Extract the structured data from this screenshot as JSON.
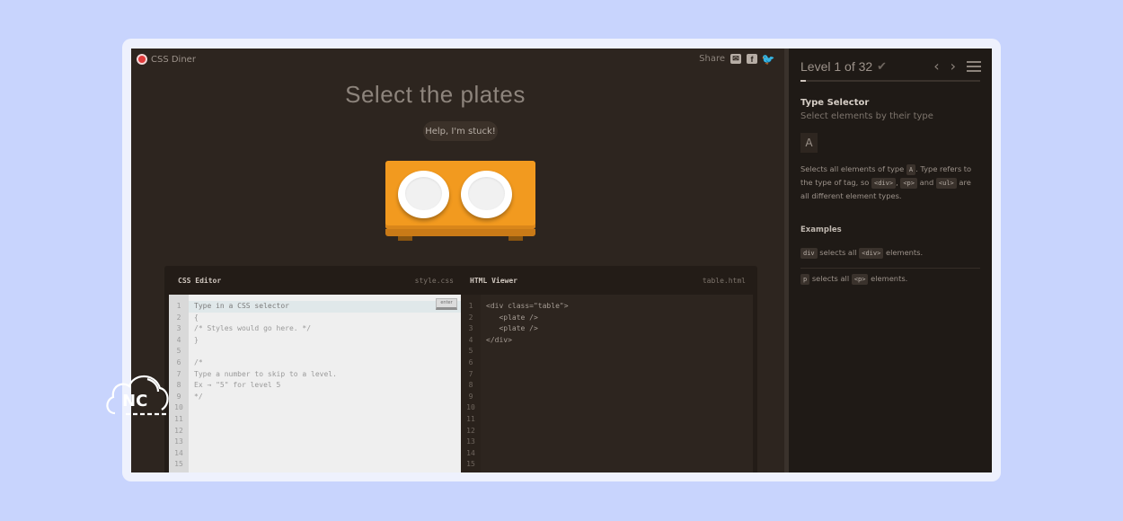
{
  "brand": {
    "name": "CSS Diner"
  },
  "share": {
    "label": "Share",
    "icons": [
      "email-icon",
      "facebook-icon",
      "twitter-icon"
    ]
  },
  "challenge": {
    "title": "Select the plates",
    "help_label": "Help, I'm stuck!"
  },
  "editor": {
    "css": {
      "title": "CSS Editor",
      "file": "style.css",
      "enter_label": "enter",
      "line_numbers": [
        "1",
        "2",
        "3",
        "4",
        "5",
        "6",
        "7",
        "8",
        "9",
        "10",
        "11",
        "12",
        "13",
        "14",
        "15"
      ],
      "lines": [
        "Type in a CSS selector",
        "{",
        "/* Styles would go here. */",
        "}",
        "",
        "/*",
        "Type a number to skip to a level.",
        "Ex → \"5\" for level 5",
        "*/"
      ]
    },
    "html": {
      "title": "HTML Viewer",
      "file": "table.html",
      "line_numbers": [
        "1",
        "2",
        "3",
        "4",
        "5",
        "6",
        "7",
        "8",
        "9",
        "10",
        "11",
        "12",
        "13",
        "14",
        "15"
      ],
      "lines": [
        "<div class=\"table\">",
        "   <plate />",
        "   <plate />",
        "</div>"
      ]
    }
  },
  "sidebar": {
    "level_label": "Level 1 of 32",
    "level_current": 1,
    "level_total": 32,
    "progress_fraction": 0.03,
    "selector_name": "Type Selector",
    "selector_title": "Select elements by their type",
    "syntax": "A",
    "description": {
      "p1": "Selects all elements of type ",
      "tag_a": "A",
      "p2": ". Type refers to the type of tag, so ",
      "tag_div": "<div>",
      "p3": ", ",
      "tag_p": "<p>",
      "p4": " and ",
      "tag_ul": "<ul>",
      "p5": " are all different element types."
    },
    "examples_title": "Examples",
    "examples": [
      {
        "code": "div",
        "mid": "selects all",
        "tag": "<div>",
        "end": "elements."
      },
      {
        "code": "p",
        "mid": "selects all",
        "tag": "<p>",
        "end": "elements."
      }
    ]
  },
  "badge": {
    "text": "NC"
  },
  "colors": {
    "background": "#c8d4fd",
    "table": "#f29a1f",
    "screen": "#2d251f",
    "sidebar": "#1f1a16"
  }
}
